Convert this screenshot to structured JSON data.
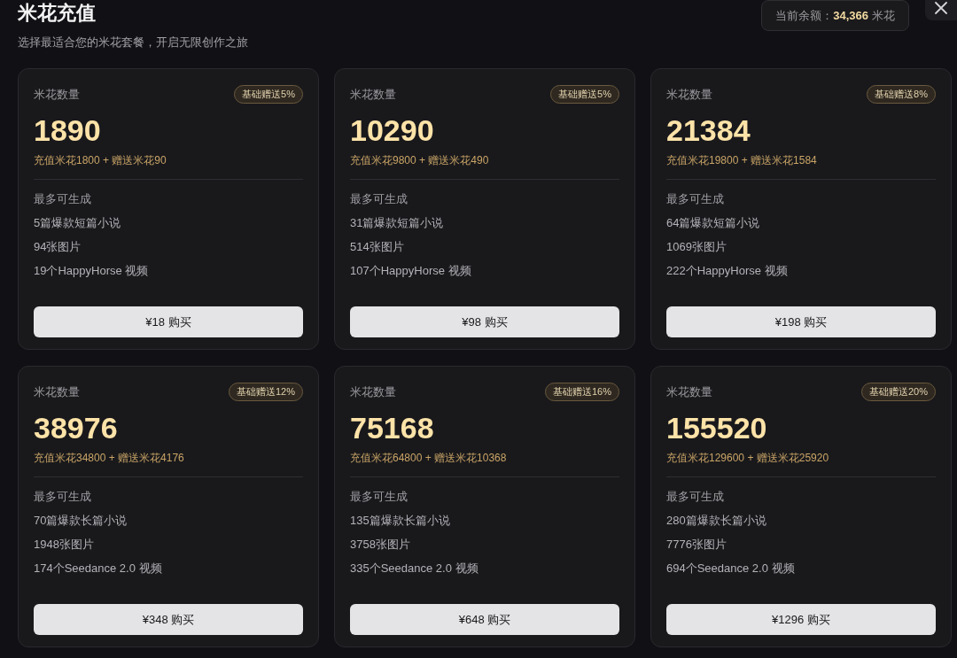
{
  "header": {
    "title": "米花充值",
    "subtitle": "选择最适合您的米花套餐，开启无限创作之旅",
    "balance": {
      "label": "当前余额：",
      "amount": "34,366",
      "unit": "米花"
    }
  },
  "packages": [
    {
      "label": "米花数量",
      "badge": "基础赠送5%",
      "amount": "1890",
      "breakdown": "充值米花1800 + 赠送米花90",
      "list_title": "最多可生成",
      "items": [
        "5篇爆款短篇小说",
        "94张图片",
        "19个HappyHorse 视频"
      ],
      "button": "¥18 购买"
    },
    {
      "label": "米花数量",
      "badge": "基础赠送5%",
      "amount": "10290",
      "breakdown": "充值米花9800 + 赠送米花490",
      "list_title": "最多可生成",
      "items": [
        "31篇爆款短篇小说",
        "514张图片",
        "107个HappyHorse 视频"
      ],
      "button": "¥98 购买"
    },
    {
      "label": "米花数量",
      "badge": "基础赠送8%",
      "amount": "21384",
      "breakdown": "充值米花19800 + 赠送米花1584",
      "list_title": "最多可生成",
      "items": [
        "64篇爆款短篇小说",
        "1069张图片",
        "222个HappyHorse 视频"
      ],
      "button": "¥198 购买"
    },
    {
      "label": "米花数量",
      "badge": "基础赠送12%",
      "amount": "38976",
      "breakdown": "充值米花34800 + 赠送米花4176",
      "list_title": "最多可生成",
      "items": [
        "70篇爆款长篇小说",
        "1948张图片",
        "174个Seedance 2.0 视频"
      ],
      "button": "¥348 购买"
    },
    {
      "label": "米花数量",
      "badge": "基础赠送16%",
      "amount": "75168",
      "breakdown": "充值米花64800 + 赠送米花10368",
      "list_title": "最多可生成",
      "items": [
        "135篇爆款长篇小说",
        "3758张图片",
        "335个Seedance 2.0 视频"
      ],
      "button": "¥648 购买"
    },
    {
      "label": "米花数量",
      "badge": "基础赠送20%",
      "amount": "155520",
      "breakdown": "充值米花129600 + 赠送米花25920",
      "list_title": "最多可生成",
      "items": [
        "280篇爆款长篇小说",
        "7776张图片",
        "694个Seedance 2.0 视频"
      ],
      "button": "¥1296 购买"
    }
  ]
}
